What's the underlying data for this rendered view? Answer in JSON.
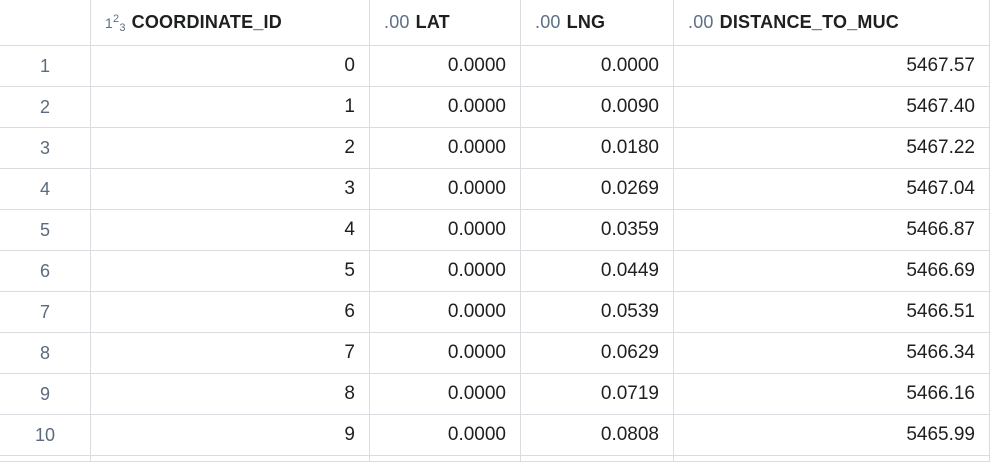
{
  "columns": [
    {
      "name": "COORDINATE_ID",
      "type_icon": "integer-type-icon"
    },
    {
      "name": "LAT",
      "type_icon": "decimal-type-icon",
      "type_label": ".00"
    },
    {
      "name": "LNG",
      "type_icon": "decimal-type-icon",
      "type_label": ".00"
    },
    {
      "name": "DISTANCE_TO_MUC",
      "type_icon": "decimal-type-icon",
      "type_label": ".00"
    }
  ],
  "int_icon": {
    "base": "1",
    "sup": "2",
    "sub": "3"
  },
  "rows": [
    {
      "n": "1",
      "id": "0",
      "lat": "0.0000",
      "lng": "0.0000",
      "dist": "5467.57"
    },
    {
      "n": "2",
      "id": "1",
      "lat": "0.0000",
      "lng": "0.0090",
      "dist": "5467.40"
    },
    {
      "n": "3",
      "id": "2",
      "lat": "0.0000",
      "lng": "0.0180",
      "dist": "5467.22"
    },
    {
      "n": "4",
      "id": "3",
      "lat": "0.0000",
      "lng": "0.0269",
      "dist": "5467.04"
    },
    {
      "n": "5",
      "id": "4",
      "lat": "0.0000",
      "lng": "0.0359",
      "dist": "5466.87"
    },
    {
      "n": "6",
      "id": "5",
      "lat": "0.0000",
      "lng": "0.0449",
      "dist": "5466.69"
    },
    {
      "n": "7",
      "id": "6",
      "lat": "0.0000",
      "lng": "0.0539",
      "dist": "5466.51"
    },
    {
      "n": "8",
      "id": "7",
      "lat": "0.0000",
      "lng": "0.0629",
      "dist": "5466.34"
    },
    {
      "n": "9",
      "id": "8",
      "lat": "0.0000",
      "lng": "0.0719",
      "dist": "5466.16"
    },
    {
      "n": "10",
      "id": "9",
      "lat": "0.0000",
      "lng": "0.0808",
      "dist": "5465.99"
    }
  ],
  "colors": {
    "border": "#d9dde2",
    "row_number": "#5b6b7d",
    "type_icon": "#5c7086"
  }
}
